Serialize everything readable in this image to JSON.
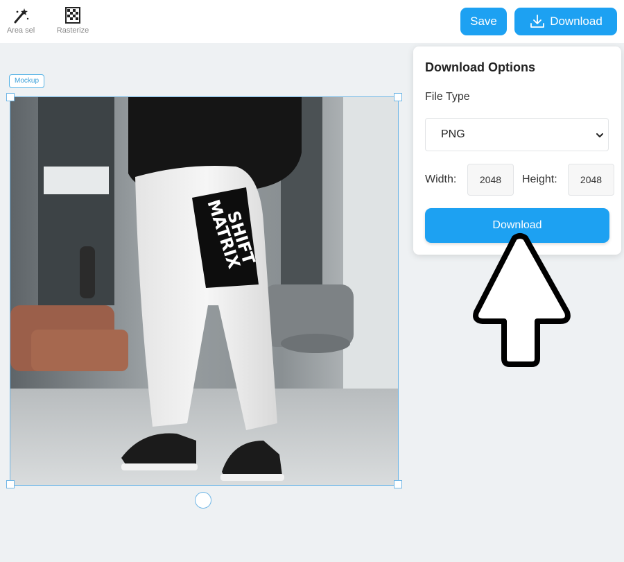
{
  "toolbar": {
    "area_sel_label": "Area sel",
    "rasterize_label": "Rasterize",
    "save_label": "Save",
    "download_label": "Download"
  },
  "canvas": {
    "layer_tag": "Mockup",
    "print_text_line1": "MATRIX",
    "print_text_line2": "SHIFT"
  },
  "download_panel": {
    "title": "Download Options",
    "file_type_label": "File Type",
    "file_type_value": "PNG",
    "width_label": "Width:",
    "width_value": "2048",
    "height_label": "Height:",
    "height_value": "2048",
    "download_button_label": "Download"
  },
  "colors": {
    "accent": "#1da1f2",
    "selection": "#6fb6e6",
    "canvas_bg": "#eef1f3"
  },
  "icons": [
    "magic-wand-icon",
    "rasterize-grid-icon",
    "download-icon",
    "chevron-down-icon",
    "up-arrow-pointer-icon"
  ]
}
